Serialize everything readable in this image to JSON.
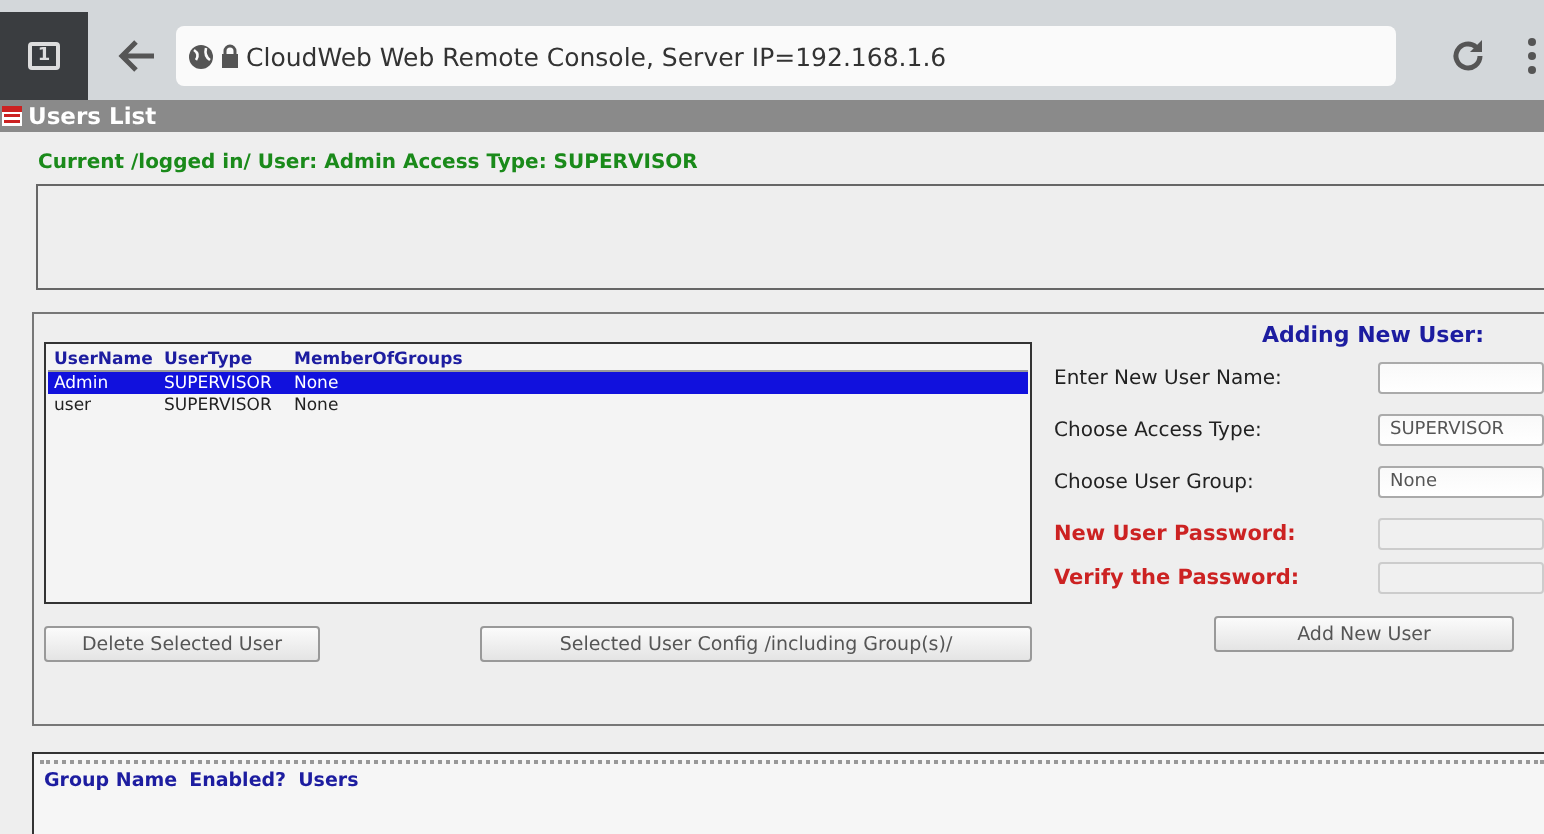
{
  "browser": {
    "tab_count": "1",
    "url": "CloudWeb Web Remote Console, Server IP=192.168.1.6"
  },
  "window": {
    "title": "Users List"
  },
  "current_user": "Current /logged in/ User: Admin Access Type: SUPERVISOR",
  "users_table": {
    "columns": [
      "UserName",
      "UserType",
      "MemberOfGroups"
    ],
    "rows": [
      {
        "cells": [
          "Admin",
          "SUPERVISOR",
          "None"
        ],
        "selected": true
      },
      {
        "cells": [
          "user",
          "SUPERVISOR",
          "None"
        ],
        "selected": false
      }
    ]
  },
  "user_buttons": [
    "Delete Selected User",
    "Selected User Config /including Group(s)/"
  ],
  "add_user": {
    "title": "Adding New User:",
    "fields": [
      {
        "label": "Enter New User Name:",
        "kind": "text"
      },
      {
        "label": "Choose Access Type:",
        "kind": "select",
        "value": "SUPERVISOR"
      },
      {
        "label": "Choose User Group:",
        "kind": "select",
        "value": "None"
      },
      {
        "label": "New User Password:",
        "kind": "password"
      },
      {
        "label": "Verify the Password:",
        "kind": "password"
      }
    ],
    "button": "Add New User"
  },
  "groups_table": {
    "columns": [
      "Group Name",
      "Enabled?",
      "Users"
    ]
  }
}
